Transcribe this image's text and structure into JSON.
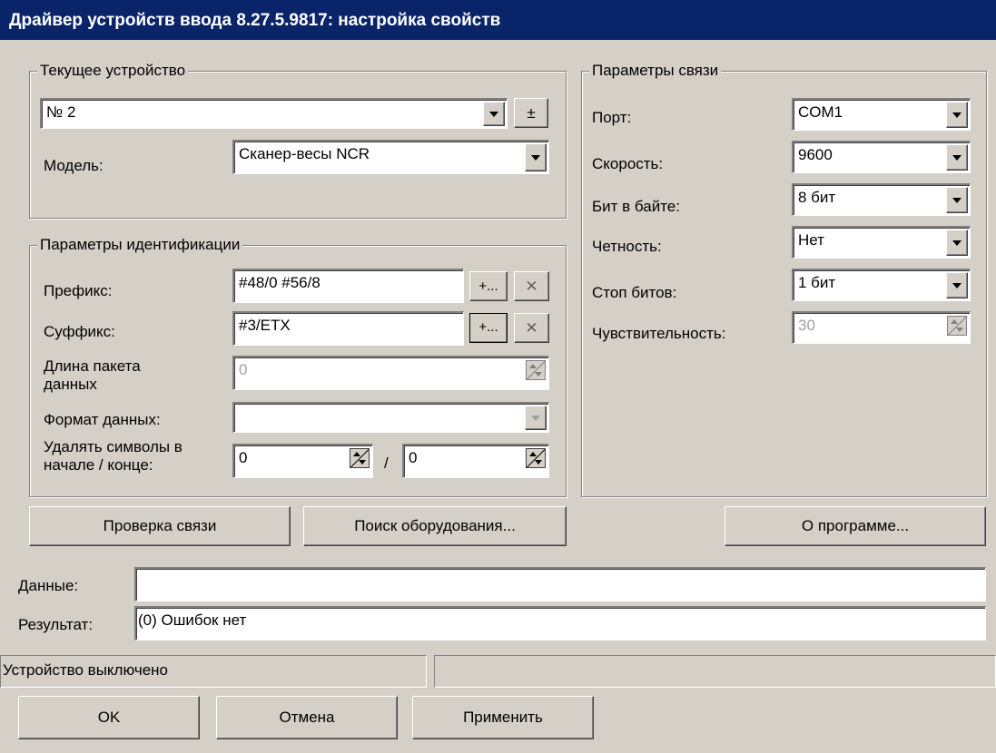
{
  "window": {
    "title": "Драйвер устройств ввода 8.27.5.9817: настройка свойств"
  },
  "current_device": {
    "legend": "Текущее устройство",
    "device_value": "№ 2",
    "plusminus_label": "±",
    "model_label": "Модель:",
    "model_value": "Сканер-весы NCR"
  },
  "identification": {
    "legend": "Параметры идентификации",
    "prefix_label": "Префикс:",
    "prefix_value": "#48/0  #56/8",
    "suffix_label": "Суффикс:",
    "suffix_value": "#3/ETX",
    "add_label": "+...",
    "clear_label": "✕",
    "packet_length_label": "Длина пакета данных",
    "packet_length_value": "0",
    "data_format_label": "Формат данных:",
    "data_format_value": "",
    "strip_label": "Удалять символы в начале / конце:",
    "strip_start_value": "0",
    "strip_separator": "/",
    "strip_end_value": "0"
  },
  "connection": {
    "legend": "Параметры связи",
    "port_label": "Порт:",
    "port_value": "COM1",
    "speed_label": "Скорость:",
    "speed_value": "9600",
    "bits_label": "Бит в байте:",
    "bits_value": "8 бит",
    "parity_label": "Четность:",
    "parity_value": "Нет",
    "stop_label": "Стоп битов:",
    "stop_value": "1 бит",
    "sensitivity_label": "Чувствительность:",
    "sensitivity_value": "30"
  },
  "actions": {
    "check_connection": "Проверка связи",
    "search_equipment": "Поиск оборудования...",
    "about": "О программе..."
  },
  "output": {
    "data_label": "Данные:",
    "data_value": "",
    "result_label": "Результат:",
    "result_value": "(0) Ошибок нет"
  },
  "status": {
    "text": "Устройство выключено",
    "right_text": ""
  },
  "footer": {
    "ok": "OK",
    "cancel": "Отмена",
    "apply": "Применить"
  }
}
